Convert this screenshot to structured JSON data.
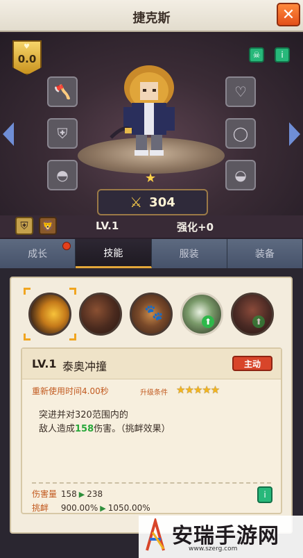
{
  "header": {
    "title": "捷克斯",
    "close_icon": "close-icon"
  },
  "character": {
    "power_badge_value": "0.0",
    "star_count": 1,
    "combat_power": "304",
    "level": "LV.1",
    "enhance": "强化+0",
    "left_slots": [
      "axe-icon",
      "armor-icon",
      "helmet-icon"
    ],
    "right_slots": [
      "amulet-icon",
      "ring-icon",
      "cap-icon"
    ]
  },
  "tabs": [
    {
      "label": "成长",
      "has_notice": true
    },
    {
      "label": "技能",
      "active": true
    },
    {
      "label": "服装"
    },
    {
      "label": "装备"
    }
  ],
  "skill_detail": {
    "level": "LV.1",
    "name": "泰奥冲撞",
    "type_tag": "主动",
    "cooldown": "重新使用时间4.00秒",
    "upgrade_label": "升级条件",
    "upgrade_stars": "★★★★★",
    "desc_line1": "突进并对320范围内的",
    "desc_line2_prefix": "敌人造成",
    "desc_damage": "158",
    "desc_line2_suffix": "伤害。（挑衅效果）",
    "stats": [
      {
        "label": "伤害量",
        "current": "158",
        "next": "238"
      },
      {
        "label": "挑衅",
        "current": "900.00%",
        "next": "1050.00%"
      }
    ]
  },
  "watermark": {
    "text": "安瑞手游网",
    "url": "www.szerg.com"
  },
  "colors": {
    "accent_orange": "#e3501a",
    "tab_active_underline": "#e3a73a",
    "highlight_green": "#28a83a",
    "label_orange": "#c25a20"
  }
}
